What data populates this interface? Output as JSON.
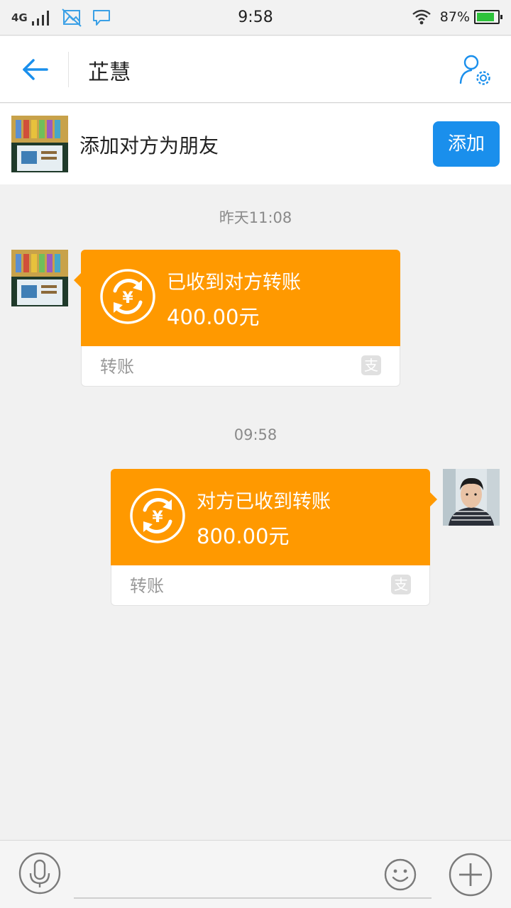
{
  "status_bar": {
    "network": "4G",
    "time": "9:58",
    "battery": "87%",
    "battery_level": 0.87
  },
  "header": {
    "title": "芷慧"
  },
  "add_friend": {
    "text": "添加对方为朋友",
    "button_label": "添加"
  },
  "messages": [
    {
      "timestamp": "昨天11:08",
      "title": "已收到对方转账",
      "amount": "400.00元",
      "footer": "转账"
    },
    {
      "timestamp": "09:58",
      "title": "对方已收到转账",
      "amount": "800.00元",
      "footer": "转账"
    }
  ],
  "colors": {
    "accent": "#1a8fec",
    "transfer_card": "#ff9900",
    "battery_fill": "#2ec23b"
  },
  "icons": [
    "back-arrow-icon",
    "user-settings-icon",
    "transfer-coin-icon",
    "alipay-icon",
    "microphone-icon",
    "emoji-icon",
    "plus-icon"
  ]
}
